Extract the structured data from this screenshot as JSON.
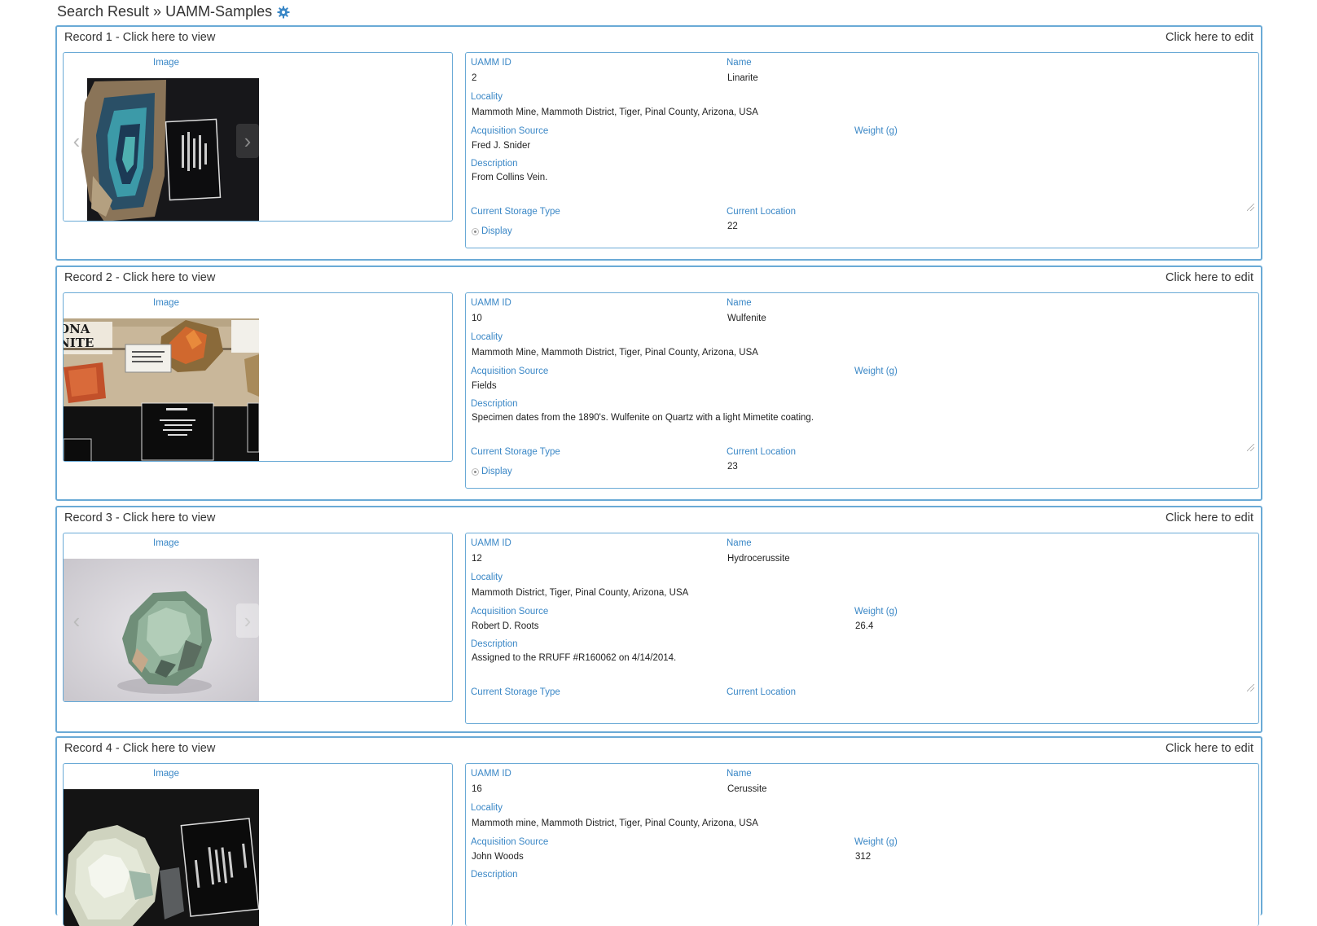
{
  "header": {
    "title": "Search Result » UAMM-Samples"
  },
  "labels": {
    "image": "Image",
    "uamm_id": "UAMM ID",
    "name": "Name",
    "locality": "Locality",
    "acquisition_source": "Acquisition Source",
    "weight": "Weight (g)",
    "description": "Description",
    "storage_type": "Current Storage Type",
    "location": "Current Location",
    "edit_link": "Click here to edit"
  },
  "colors": {
    "accent": "#3a87c6",
    "border": "#6aaad6"
  },
  "records": [
    {
      "title": "Record 1 - Click here to view",
      "uamm_id": "2",
      "name": "Linarite",
      "locality": "Mammoth Mine, Mammoth District, Tiger, Pinal County, Arizona, USA",
      "acquisition_source": "Fred J. Snider",
      "weight": "",
      "description": "From Collins Vein.",
      "storage_type": "Display",
      "location": "22"
    },
    {
      "title": "Record 2 - Click here to view",
      "uamm_id": "10",
      "name": "Wulfenite",
      "locality": "Mammoth Mine, Mammoth District, Tiger, Pinal County, Arizona, USA",
      "acquisition_source": "Fields",
      "weight": "",
      "description": "Specimen dates from the 1890's.  Wulfenite on Quartz with a light Mimetite coating.",
      "storage_type": "Display",
      "location": "23"
    },
    {
      "title": "Record 3 - Click here to view",
      "uamm_id": "12",
      "name": "Hydrocerussite",
      "locality": "Mammoth District, Tiger, Pinal County, Arizona, USA",
      "acquisition_source": "Robert D. Roots",
      "weight": "26.4",
      "description": "Assigned to the RRUFF #R160062 on 4/14/2014.",
      "storage_type": "",
      "location": ""
    },
    {
      "title": "Record 4 - Click here to view",
      "uamm_id": "16",
      "name": "Cerussite",
      "locality": "Mammoth mine, Mammoth District, Tiger, Pinal County, Arizona, USA",
      "acquisition_source": "John Woods",
      "weight": "312",
      "description": "",
      "storage_type": "",
      "location": ""
    }
  ]
}
